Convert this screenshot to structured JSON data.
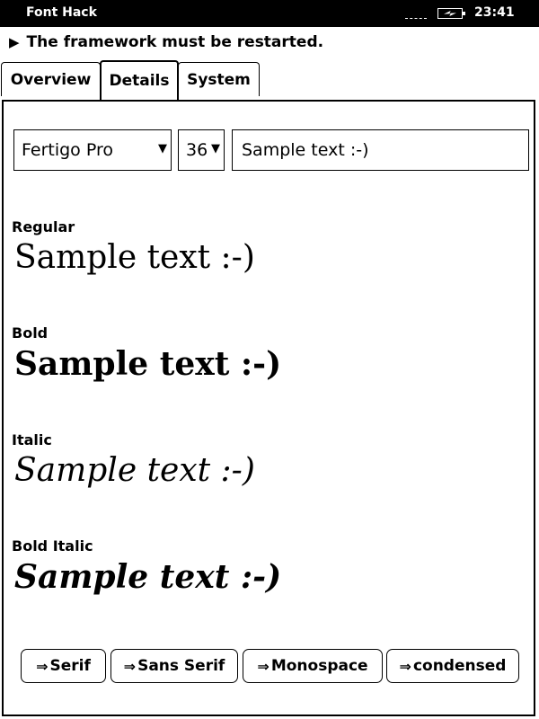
{
  "statusbar": {
    "title": "Font Hack",
    "time": "23:41",
    "icons": [
      "signal-icon",
      "battery-charging-icon"
    ]
  },
  "notice": {
    "arrow": "▶",
    "text": "The framework must be restarted."
  },
  "tabs": [
    {
      "label": "Overview",
      "active": false
    },
    {
      "label": "Details",
      "active": true
    },
    {
      "label": "System",
      "active": false
    }
  ],
  "controls": {
    "font_select": "Fertigo Pro",
    "size_select": "36",
    "caret": "▼",
    "sample_input": "Sample text :-)"
  },
  "styles": [
    {
      "label": "Regular",
      "sample": "Sample text :-)"
    },
    {
      "label": "Bold",
      "sample": "Sample text :-)"
    },
    {
      "label": "Italic",
      "sample": "Sample text :-)"
    },
    {
      "label": "Bold Italic",
      "sample": "Sample text :-)"
    }
  ],
  "buttons": {
    "arrow": "⇒",
    "serif": "Serif",
    "sans_serif": "Sans Serif",
    "monospace": "Monospace",
    "condensed": "condensed"
  }
}
